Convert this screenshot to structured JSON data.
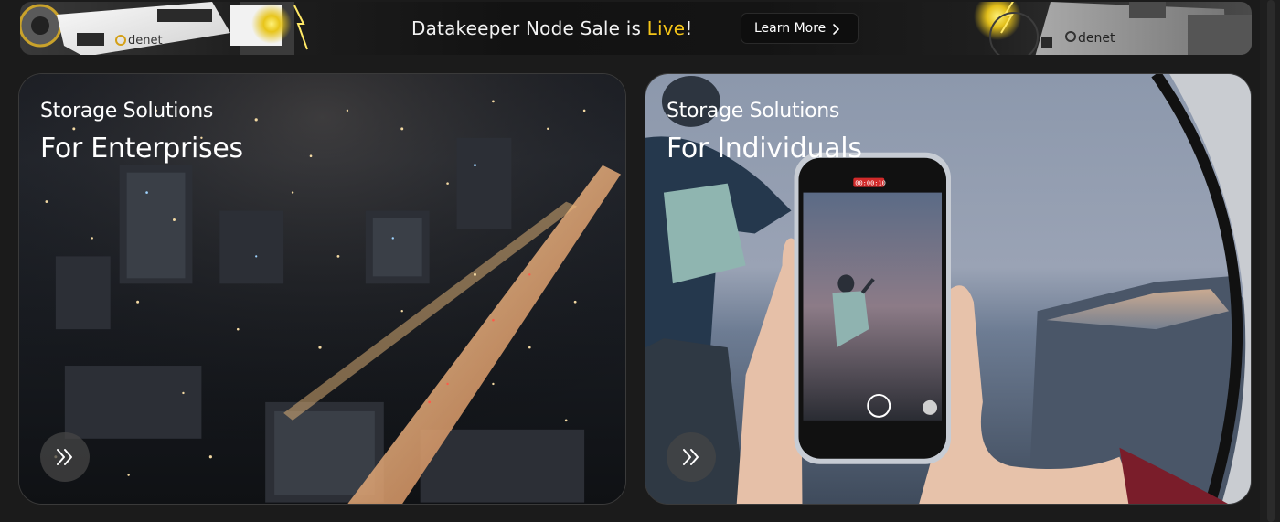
{
  "banner": {
    "message_prefix": "Datakeeper Node Sale is ",
    "message_accent": "Live",
    "message_suffix": "!",
    "button_label": "Learn More",
    "left_device_brand": "denet",
    "right_device_brand": "denet",
    "accent_color": "#f5c518"
  },
  "cards": [
    {
      "eyebrow": "Storage Solutions",
      "title": "For Enterprises",
      "icon": "double-chevron-right-icon"
    },
    {
      "eyebrow": "Storage Solutions",
      "title": "For Individuals",
      "icon": "double-chevron-right-icon"
    }
  ],
  "phone": {
    "recording_time": "00:00:10"
  }
}
